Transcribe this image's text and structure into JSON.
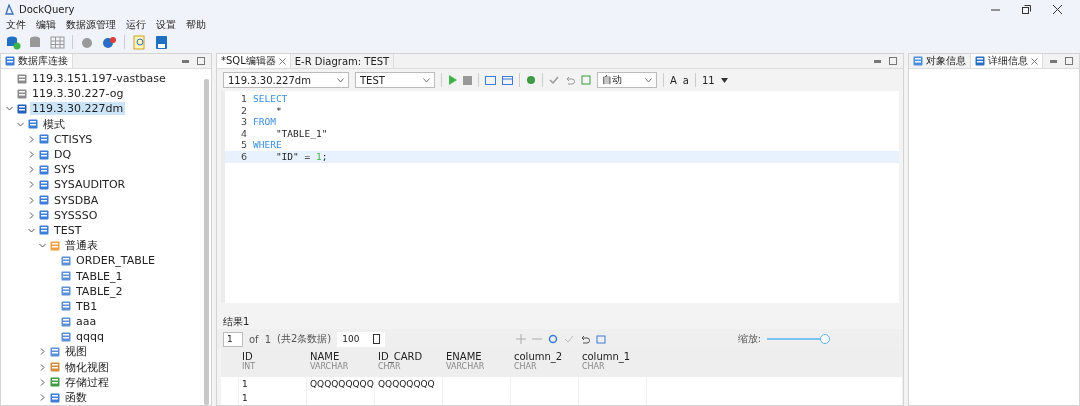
{
  "window": {
    "title": "DockQuery"
  },
  "menu": [
    "文件",
    "编辑",
    "数据源管理",
    "运行",
    "设置",
    "帮助"
  ],
  "left_panel": {
    "title": "数据库连接",
    "tree": [
      {
        "label": "119.3.151.197-vastbase",
        "kind": "connection",
        "selected": false
      },
      {
        "label": "119.3.30.227-og",
        "kind": "connection",
        "selected": false
      },
      {
        "label": "119.3.30.227dm",
        "kind": "connection-active",
        "selected": true,
        "expanded": true,
        "children": [
          {
            "label": "模式",
            "kind": "schema",
            "selected": false,
            "expanded": true,
            "children": [
              {
                "label": "CTISYS",
                "kind": "schema",
                "selected": false,
                "expanded": false
              },
              {
                "label": "DQ",
                "kind": "schema",
                "selected": false,
                "expanded": false
              },
              {
                "label": "SYS",
                "kind": "schema",
                "selected": false,
                "expanded": false
              },
              {
                "label": "SYSAUDITOR",
                "kind": "schema",
                "selected": false,
                "expanded": false
              },
              {
                "label": "SYSDBA",
                "kind": "schema",
                "selected": false,
                "expanded": false
              },
              {
                "label": "SYSSSO",
                "kind": "schema",
                "selected": false,
                "expanded": false
              },
              {
                "label": "TEST",
                "kind": "schema",
                "selected": false,
                "expanded": true,
                "children": [
                  {
                    "label": "普通表",
                    "kind": "folder",
                    "selected": false,
                    "expanded": true,
                    "children": [
                      {
                        "label": "ORDER_TABLE",
                        "kind": "table",
                        "selected": false
                      },
                      {
                        "label": "TABLE_1",
                        "kind": "table",
                        "selected": false
                      },
                      {
                        "label": "TABLE_2",
                        "kind": "table",
                        "selected": false
                      },
                      {
                        "label": "TB1",
                        "kind": "table",
                        "selected": false
                      },
                      {
                        "label": "aaa",
                        "kind": "table",
                        "selected": false
                      },
                      {
                        "label": "qqqq",
                        "kind": "table",
                        "selected": false
                      }
                    ]
                  },
                  {
                    "label": "视图",
                    "kind": "view",
                    "selected": false,
                    "expanded": false
                  },
                  {
                    "label": "物化视图",
                    "kind": "mview",
                    "selected": false,
                    "expanded": false
                  },
                  {
                    "label": "存储过程",
                    "kind": "procedure",
                    "selected": false,
                    "expanded": false
                  },
                  {
                    "label": "函数",
                    "kind": "function",
                    "selected": false,
                    "expanded": false
                  }
                ]
              }
            ]
          }
        ]
      }
    ]
  },
  "editor_tabs": [
    {
      "label": "*SQL编辑器",
      "selected": true,
      "closable": true
    },
    {
      "label": "E-R Diagram: TEST",
      "selected": false,
      "closable": false
    }
  ],
  "editor_toolbar": {
    "connection": "119.3.30.227dm",
    "schema": "TEST",
    "commit_mode": "自动",
    "font_big": "A",
    "font_small": "a",
    "font_size": "11"
  },
  "code": [
    {
      "number": "1",
      "current": false,
      "tokens": [
        {
          "kind": "keyword",
          "text": "SELECT"
        }
      ]
    },
    {
      "number": "2",
      "current": false,
      "tokens": [
        {
          "kind": "plain",
          "text": "    *"
        }
      ]
    },
    {
      "number": "3",
      "current": false,
      "tokens": [
        {
          "kind": "keyword",
          "text": "FROM"
        }
      ]
    },
    {
      "number": "4",
      "current": false,
      "tokens": [
        {
          "kind": "plain",
          "text": "    \"TABLE_1\""
        }
      ]
    },
    {
      "number": "5",
      "current": false,
      "tokens": [
        {
          "kind": "keyword",
          "text": "WHERE"
        }
      ]
    },
    {
      "number": "6",
      "current": true,
      "tokens": [
        {
          "kind": "plain",
          "text": "    \"ID\" = "
        },
        {
          "kind": "number",
          "text": "1"
        },
        {
          "kind": "plain",
          "text": ";"
        }
      ]
    }
  ],
  "results": {
    "tab": "结果1",
    "page": "1",
    "of": "of",
    "pages": "1",
    "count": "(共2条数据)",
    "page_size": "100",
    "zoom_label": "缩放:",
    "zoom": {
      "level": 1
    },
    "columns": [
      {
        "name": "ID",
        "type": "INT"
      },
      {
        "name": "NAME",
        "type": "VARCHAR"
      },
      {
        "name": "ID_CARD",
        "type": "CHAR"
      },
      {
        "name": "ENAME",
        "type": "VARCHAR"
      },
      {
        "name": "column_2",
        "type": "CHAR"
      },
      {
        "name": "column_1",
        "type": "CHAR"
      }
    ],
    "rows": [
      [
        "1",
        "QQQQQQQQQ",
        "QQQQQQQQ"
      ],
      [
        "1"
      ]
    ]
  },
  "right_panel": {
    "tabs": [
      {
        "label": "对象信息",
        "selected": false,
        "closable": false
      },
      {
        "label": "详细信息",
        "selected": true,
        "closable": true
      }
    ]
  }
}
